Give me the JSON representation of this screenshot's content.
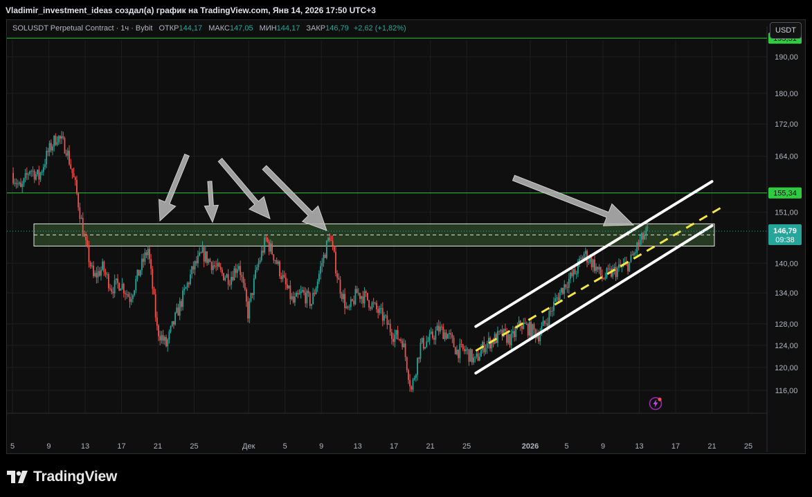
{
  "header": {
    "attribution": "Vladimir_investment_ideas создал(а) график на TradingView.com, Янв 14, 2026 17:50 UTC+3"
  },
  "legend": {
    "symbol": "SOLUSDT Perpetual Contract · 1ч · Bybit",
    "open_label": "ОТКР",
    "open_value": "144,17",
    "high_label": "МАКС",
    "high_value": "147,05",
    "low_label": "МИН",
    "low_value": "144,17",
    "close_label": "ЗАКР",
    "close_value": "146,79",
    "change": "+2,62 (+1,82%)"
  },
  "toolbar": {
    "currency": "USDT"
  },
  "colors": {
    "up": "#26a69a",
    "down": "#ef5350",
    "level_line": "#2ecc40",
    "channel": "#ffffff",
    "midline": "#f5e642",
    "zone_fill": "#2f4a28",
    "arrow": "#b8b8b8",
    "last_price_bg": "#26a69a"
  },
  "icons": {
    "alert": "lightning-alert-icon",
    "logo": "tradingview-logo-icon"
  },
  "brand": {
    "name": "TradingView"
  },
  "chart_data": {
    "type": "candlestick",
    "symbol": "SOLUSDT",
    "interval": "1h",
    "y_scale": "log",
    "ylim": [
      112,
      199
    ],
    "y_ticks": [
      "190,00",
      "180,00",
      "172,00",
      "164,00",
      "151,00",
      "140,00",
      "134,00",
      "128,00",
      "124,00",
      "120,00",
      "116,00"
    ],
    "x_ticks": [
      "5",
      "9",
      "13",
      "17",
      "21",
      "25",
      "Дек",
      "5",
      "9",
      "13",
      "17",
      "21",
      "25",
      "2026",
      "5",
      "9",
      "13",
      "17",
      "21",
      "25"
    ],
    "grid": true,
    "price_series": {
      "dates": [
        "2025-11-05",
        "2025-11-06",
        "2025-11-07",
        "2025-11-08",
        "2025-11-09",
        "2025-11-10",
        "2025-11-11",
        "2025-11-12",
        "2025-11-13",
        "2025-11-14",
        "2025-11-15",
        "2025-11-16",
        "2025-11-17",
        "2025-11-18",
        "2025-11-19",
        "2025-11-20",
        "2025-11-21",
        "2025-11-22",
        "2025-11-23",
        "2025-11-24",
        "2025-11-25",
        "2025-11-26",
        "2025-11-27",
        "2025-11-28",
        "2025-11-29",
        "2025-11-30",
        "2025-12-01",
        "2025-12-02",
        "2025-12-03",
        "2025-12-04",
        "2025-12-05",
        "2025-12-06",
        "2025-12-07",
        "2025-12-08",
        "2025-12-09",
        "2025-12-10",
        "2025-12-11",
        "2025-12-12",
        "2025-12-13",
        "2025-12-14",
        "2025-12-15",
        "2025-12-16",
        "2025-12-17",
        "2025-12-18",
        "2025-12-19",
        "2025-12-20",
        "2025-12-21",
        "2025-12-22",
        "2025-12-23",
        "2025-12-24",
        "2025-12-25",
        "2025-12-26",
        "2025-12-27",
        "2025-12-28",
        "2025-12-29",
        "2025-12-30",
        "2025-12-31",
        "2026-01-01",
        "2026-01-02",
        "2026-01-03",
        "2026-01-04",
        "2026-01-05",
        "2026-01-06",
        "2026-01-07",
        "2026-01-08",
        "2026-01-09",
        "2026-01-10",
        "2026-01-11",
        "2026-01-12",
        "2026-01-13",
        "2026-01-14"
      ],
      "prices": [
        160,
        156,
        161,
        159,
        165,
        169,
        166,
        157,
        145,
        137,
        139,
        135,
        136,
        133,
        138,
        143,
        127,
        124,
        129,
        134,
        139,
        142,
        140,
        138,
        137,
        140,
        130,
        139,
        145,
        141,
        136,
        132,
        134,
        132,
        139,
        146,
        136,
        130,
        134,
        133,
        131,
        129,
        126,
        125,
        116,
        124,
        125,
        127,
        126,
        123,
        123,
        121,
        124,
        125,
        126,
        125,
        128,
        127,
        126,
        129,
        133,
        136,
        138,
        142,
        140,
        137,
        138,
        139,
        140,
        144,
        146.79
      ]
    },
    "levels": [
      {
        "label": "195,31",
        "price": 195.31
      },
      {
        "label": "155,34",
        "price": 155.34
      }
    ],
    "zone": {
      "from_price": 143.6,
      "to_price": 148.4,
      "mid_price": 146.0
    },
    "channel": {
      "upper": [
        {
          "date": "2025-12-26",
          "price": 127.5
        },
        {
          "date": "2026-01-21",
          "price": 158
        }
      ],
      "lower": [
        {
          "date": "2025-12-26",
          "price": 119
        },
        {
          "date": "2026-01-21",
          "price": 148
        }
      ],
      "mid": [
        {
          "date": "2025-12-26",
          "price": 123
        },
        {
          "date": "2026-01-22",
          "price": 152
        }
      ]
    },
    "last_price": {
      "value": "146,79",
      "countdown": "09:38"
    }
  }
}
